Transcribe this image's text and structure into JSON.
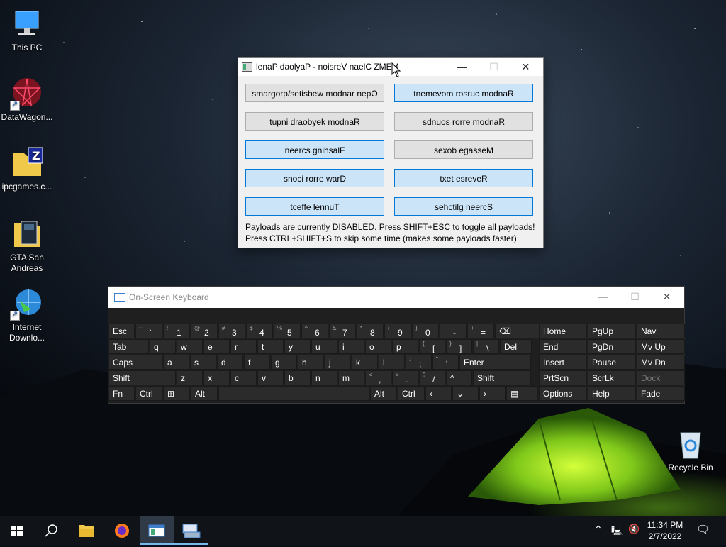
{
  "desktop": {
    "icons": [
      {
        "label": "This PC"
      },
      {
        "label": "DataWagon..."
      },
      {
        "label": "ipcgames.c..."
      },
      {
        "label": "GTA San Andreas"
      },
      {
        "label": "Internet Downlo..."
      },
      {
        "label": "Recycle Bin"
      }
    ]
  },
  "memz": {
    "title": "lenaP daolyaP - noisreV naelC ZMEM",
    "buttons": [
      {
        "label": "smargorp/setisbew modnar nepO",
        "active": false
      },
      {
        "label": "tnemevom rosruc modnaR",
        "active": true
      },
      {
        "label": "tupni draobyek modnaR",
        "active": false
      },
      {
        "label": "sdnuos rorre modnaR",
        "active": false
      },
      {
        "label": "neercs gnihsalF",
        "active": true
      },
      {
        "label": "sexob egasseM",
        "active": false
      },
      {
        "label": "snoci rorre warD",
        "active": true
      },
      {
        "label": "txet esreveR",
        "active": true
      },
      {
        "label": "tceffe lennuT",
        "active": true
      },
      {
        "label": "sehctilg neercS",
        "active": true
      }
    ],
    "status_line1": "Payloads are currently DISABLED. Press SHIFT+ESC to toggle all payloads!",
    "status_line2": "Press CTRL+SHIFT+S to skip some time (makes some payloads faster)"
  },
  "osk": {
    "title": "On-Screen Keyboard",
    "row1": [
      {
        "main": "Esc"
      },
      {
        "shift": "~",
        "main": "`"
      },
      {
        "shift": "!",
        "main": "1"
      },
      {
        "shift": "@",
        "main": "2"
      },
      {
        "shift": "#",
        "main": "3"
      },
      {
        "shift": "$",
        "main": "4"
      },
      {
        "shift": "%",
        "main": "5"
      },
      {
        "shift": "^",
        "main": "6"
      },
      {
        "shift": "&",
        "main": "7"
      },
      {
        "shift": "*",
        "main": "8"
      },
      {
        "shift": "(",
        "main": "9"
      },
      {
        "shift": ")",
        "main": "0"
      },
      {
        "shift": "_",
        "main": "-"
      },
      {
        "shift": "+",
        "main": "="
      },
      {
        "main": "⌫"
      }
    ],
    "row2": [
      "Tab",
      "q",
      "w",
      "e",
      "r",
      "t",
      "y",
      "u",
      "i",
      "o",
      "p",
      "[",
      "]",
      "\\",
      "Del"
    ],
    "row2_shift": [
      "",
      "",
      "",
      "",
      "",
      "",
      "",
      "",
      "",
      "",
      "",
      "{",
      "}",
      "|",
      ""
    ],
    "row3": [
      "Caps",
      "a",
      "s",
      "d",
      "f",
      "g",
      "h",
      "j",
      "k",
      "l",
      ";",
      "'",
      "Enter"
    ],
    "row3_shift": [
      "",
      "",
      "",
      "",
      "",
      "",
      "",
      "",
      "",
      "",
      ":",
      "\"",
      ""
    ],
    "row4": [
      "Shift",
      "z",
      "x",
      "c",
      "v",
      "b",
      "n",
      "m",
      ",",
      ".",
      "/",
      "^",
      "Shift"
    ],
    "row4_shift": [
      "",
      "",
      "",
      "",
      "",
      "",
      "",
      "",
      "<",
      ">",
      "?",
      "",
      ""
    ],
    "row5": [
      "Fn",
      "Ctrl",
      "⊞",
      "Alt",
      "",
      "Alt",
      "Ctrl",
      "‹",
      "⌄",
      "›",
      "▤"
    ],
    "nav": [
      [
        "Home",
        "PgUp",
        "Nav"
      ],
      [
        "End",
        "PgDn",
        "Mv Up"
      ],
      [
        "Insert",
        "Pause",
        "Mv Dn"
      ],
      [
        "PrtScn",
        "ScrLk",
        "Dock"
      ],
      [
        "Options",
        "Help",
        "Fade"
      ]
    ]
  },
  "taskbar": {
    "time": "11:34 PM",
    "date": "2/7/2022"
  }
}
